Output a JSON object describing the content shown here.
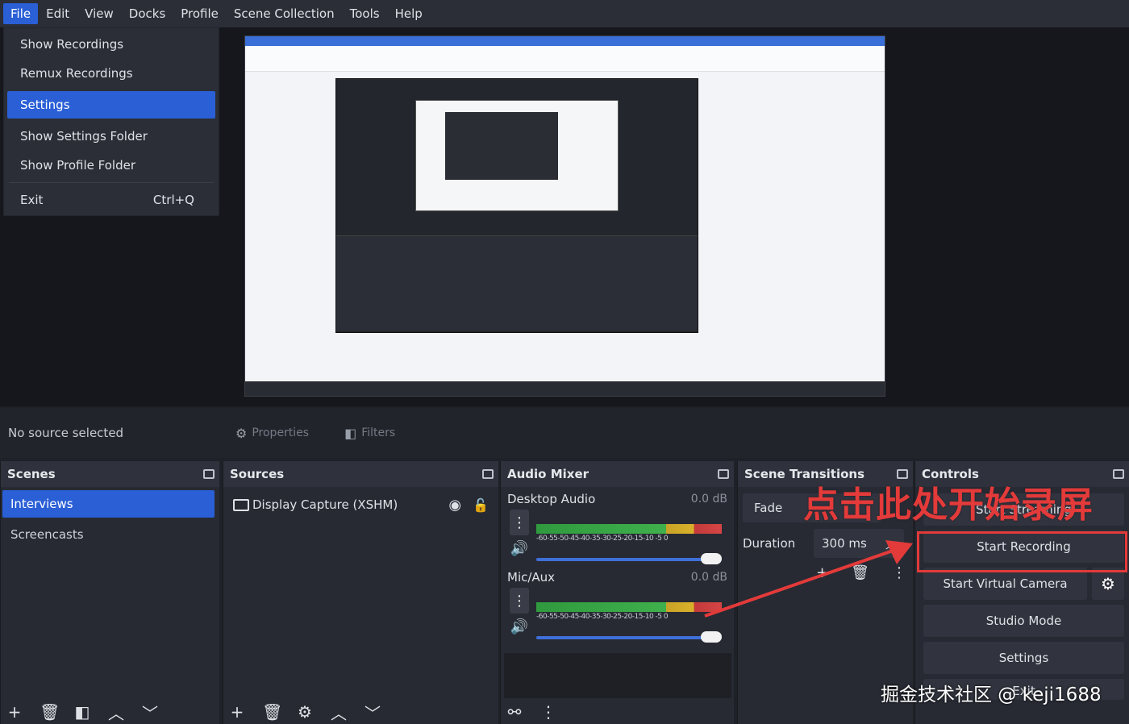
{
  "menu": [
    "File",
    "Edit",
    "View",
    "Docks",
    "Profile",
    "Scene Collection",
    "Tools",
    "Help"
  ],
  "file_menu": {
    "items": [
      {
        "label": "Show Recordings"
      },
      {
        "label": "Remux Recordings"
      },
      {
        "label": "Settings"
      },
      {
        "label": "Show Settings Folder"
      },
      {
        "label": "Show Profile Folder"
      },
      {
        "label": "Exit",
        "shortcut": "Ctrl+Q"
      }
    ]
  },
  "context_bar": {
    "status": "No source selected",
    "properties": "Properties",
    "filters": "Filters"
  },
  "scenes": {
    "title": "Scenes",
    "items": [
      "Interviews",
      "Screencasts"
    ]
  },
  "sources": {
    "title": "Sources",
    "items": [
      "Display Capture (XSHM)"
    ]
  },
  "audio_mixer": {
    "title": "Audio Mixer",
    "channels": [
      {
        "name": "Desktop Audio",
        "level": "0.0 dB",
        "ticks": "-60-55-50-45-40-35-30-25-20-15-10 -5  0"
      },
      {
        "name": "Mic/Aux",
        "level": "0.0 dB",
        "ticks": "-60-55-50-45-40-35-30-25-20-15-10 -5  0"
      }
    ]
  },
  "transitions": {
    "title": "Scene Transitions",
    "type": "Fade",
    "duration_label": "Duration",
    "duration_value": "300 ms"
  },
  "controls": {
    "title": "Controls",
    "start_streaming": "Start Streaming",
    "start_recording": "Start Recording",
    "start_virtual_camera": "Start Virtual Camera",
    "studio_mode": "Studio Mode",
    "settings": "Settings",
    "exit": "Exit"
  },
  "annotation": {
    "text": "点击此处开始录屏",
    "color": "#e33a3a"
  },
  "watermark": "掘金技术社区 @ keji1688",
  "colors": {
    "accent": "#2a5fd6",
    "annotation": "#e33a3a"
  }
}
